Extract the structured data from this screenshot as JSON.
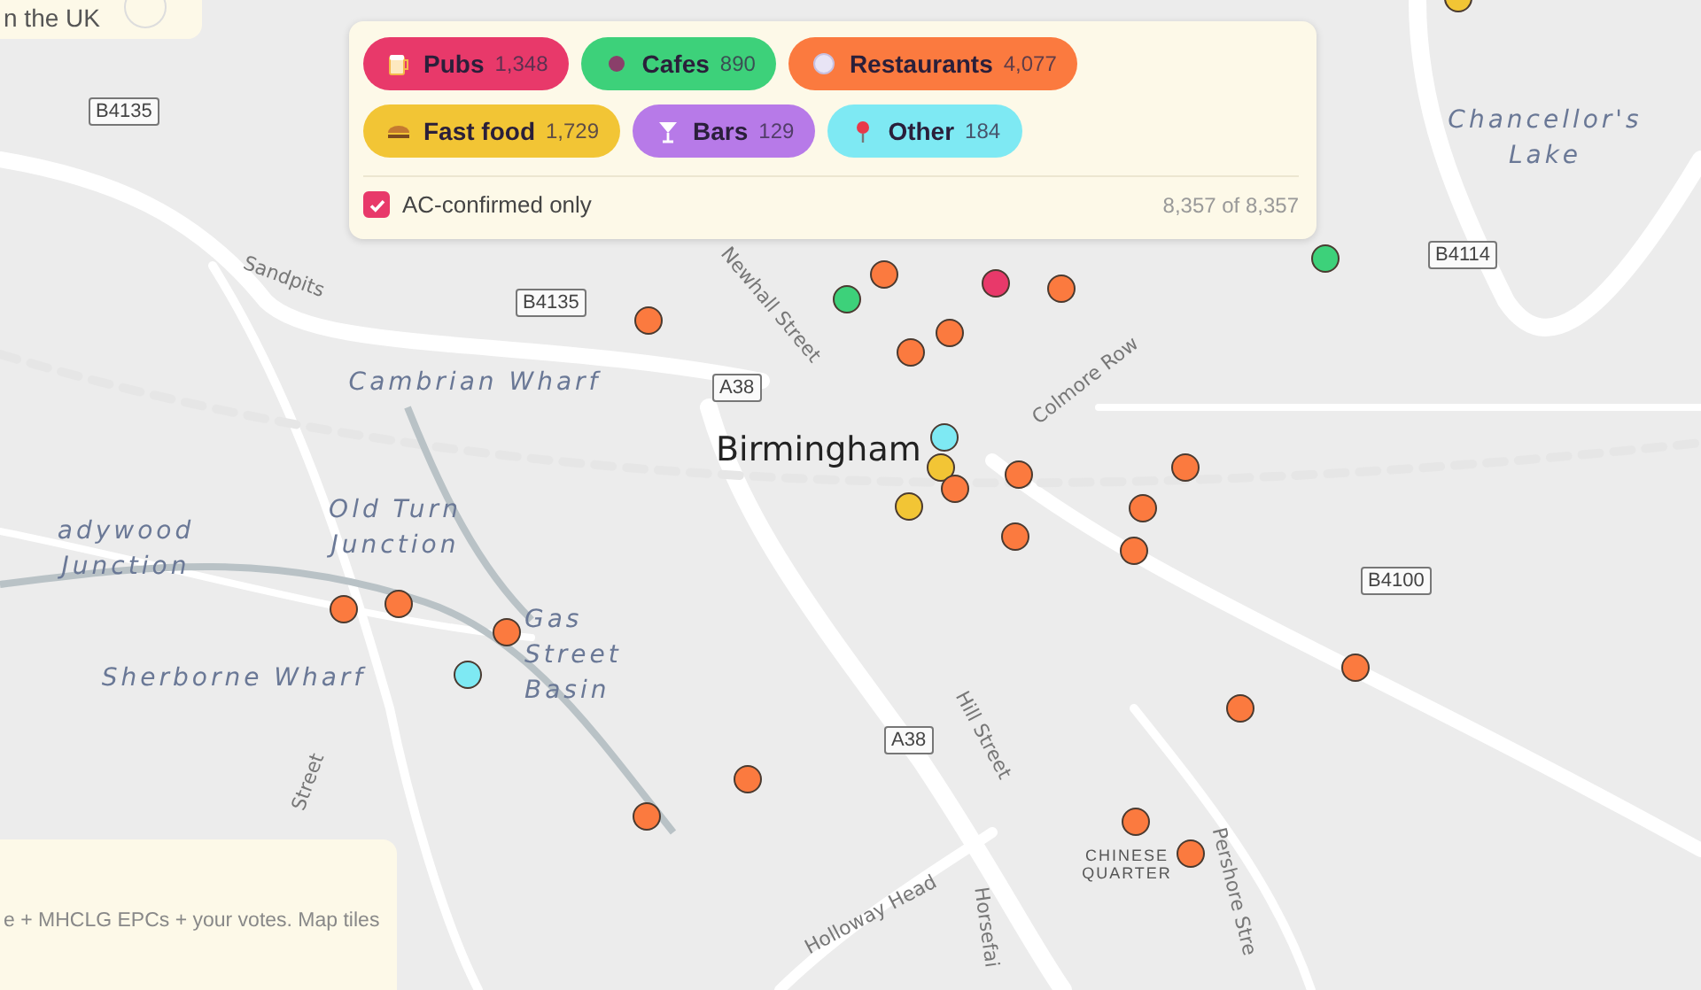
{
  "top_panel": {
    "text": "n the UK"
  },
  "filters": {
    "chips": [
      {
        "kind": "pub",
        "label": "Pubs",
        "count": "1,348",
        "color": "#e8396a"
      },
      {
        "kind": "cafe",
        "label": "Cafes",
        "count": "890",
        "color": "#3dd17a"
      },
      {
        "kind": "restaurant",
        "label": "Restaurants",
        "count": "4,077",
        "color": "#fb7a3f"
      },
      {
        "kind": "fastfood",
        "label": "Fast food",
        "count": "1,729",
        "color": "#f2c535"
      },
      {
        "kind": "bar",
        "label": "Bars",
        "count": "129",
        "color": "#b77ae8"
      },
      {
        "kind": "other",
        "label": "Other",
        "count": "184",
        "color": "#7ee9f3"
      }
    ],
    "confirmed": {
      "label": "AC-confirmed only",
      "checked": true
    },
    "total": "8,357 of 8,357"
  },
  "map": {
    "labels": [
      {
        "kind": "road",
        "text": "B4135"
      },
      {
        "kind": "road",
        "text": "B4135"
      },
      {
        "kind": "road",
        "text": "A38"
      },
      {
        "kind": "road",
        "text": "B4114"
      },
      {
        "kind": "road",
        "text": "B4100"
      },
      {
        "kind": "road",
        "text": "A38"
      },
      {
        "kind": "water",
        "text": "Chancellor's Lake"
      },
      {
        "kind": "water",
        "text": "Cambrian Wharf"
      },
      {
        "kind": "water",
        "text": "Old Turn Junction"
      },
      {
        "kind": "water",
        "text": "adywood Junction"
      },
      {
        "kind": "water",
        "text": "Sherborne Wharf"
      },
      {
        "kind": "water",
        "text": "Gas Street Basin"
      },
      {
        "kind": "city",
        "text": "Birmingham"
      },
      {
        "kind": "street",
        "text": "Sandpits"
      },
      {
        "kind": "street",
        "text": "Newhall Street"
      },
      {
        "kind": "street",
        "text": "Colmore Row"
      },
      {
        "kind": "street",
        "text": "Hill Street"
      },
      {
        "kind": "street",
        "text": "Holloway Head"
      },
      {
        "kind": "street",
        "text": "Horsefai"
      },
      {
        "kind": "street",
        "text": "Pershore Stre"
      },
      {
        "kind": "street",
        "text": "Street"
      },
      {
        "kind": "district",
        "text": "CHINESE QUARTER"
      }
    ],
    "markers": [
      {
        "color": "#f2c535"
      },
      {
        "color": "#3dd17a"
      },
      {
        "color": "#fb7a3f"
      },
      {
        "color": "#e8396a"
      },
      {
        "color": "#fb7a3f"
      },
      {
        "color": "#3dd17a"
      },
      {
        "color": "#fb7a3f"
      },
      {
        "color": "#fb7a3f"
      },
      {
        "color": "#fb7a3f"
      },
      {
        "color": "#7ee9f3"
      },
      {
        "color": "#f2c535"
      },
      {
        "color": "#fb7a3f"
      },
      {
        "color": "#fb7a3f"
      },
      {
        "color": "#fb7a3f"
      },
      {
        "color": "#f2c535"
      },
      {
        "color": "#fb7a3f"
      },
      {
        "color": "#fb7a3f"
      },
      {
        "color": "#fb7a3f"
      },
      {
        "color": "#fb7a3f"
      },
      {
        "color": "#fb7a3f"
      },
      {
        "color": "#fb7a3f"
      },
      {
        "color": "#7ee9f3"
      },
      {
        "color": "#fb7a3f"
      },
      {
        "color": "#fb7a3f"
      },
      {
        "color": "#fb7a3f"
      },
      {
        "color": "#fb7a3f"
      },
      {
        "color": "#fb7a3f"
      },
      {
        "color": "#fb7a3f"
      }
    ]
  },
  "attribution": {
    "text": "e + MHCLG EPCs + your votes. Map tiles"
  }
}
